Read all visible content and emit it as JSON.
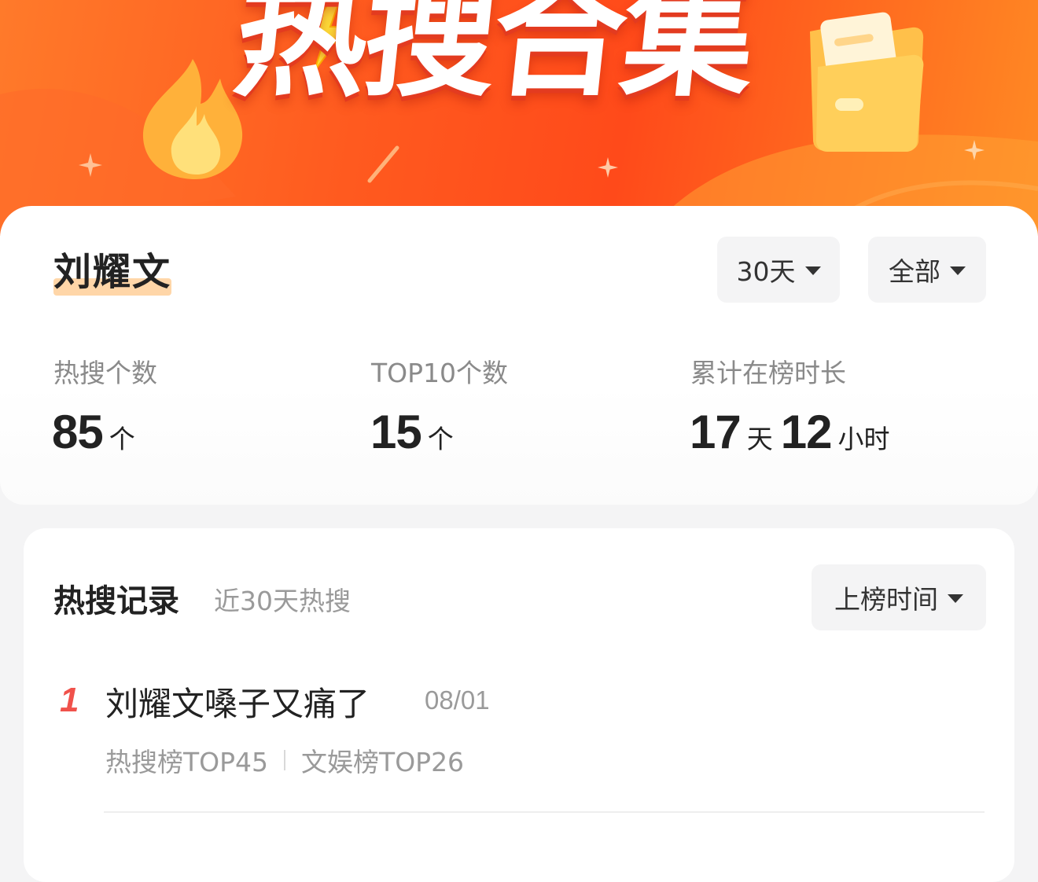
{
  "banner": {
    "title": "热搜合集",
    "colors": {
      "base": "#ff5a1f",
      "flame": "#ffb13a",
      "folder": "#ffc04a"
    },
    "icons": [
      "flame-icon",
      "lightning-icon",
      "folder-icon",
      "sparkle-icon"
    ]
  },
  "summary": {
    "name": "刘耀文",
    "filters": {
      "period": "30天",
      "scope": "全部"
    },
    "stats": [
      {
        "label": "热搜个数",
        "value": "85",
        "unit": "个"
      },
      {
        "label": "TOP10个数",
        "value": "15",
        "unit": "个"
      },
      {
        "label": "累计在榜时长",
        "days": "17",
        "days_unit": "天",
        "hours": "12",
        "hours_unit": "小时"
      }
    ]
  },
  "records": {
    "title": "热搜记录",
    "subtitle": "近30天热搜",
    "sort": "上榜时间",
    "items": [
      {
        "rank": "1",
        "title": "刘耀文嗓子又痛了",
        "date": "08/01",
        "tags": [
          "热搜榜TOP45",
          "文娱榜TOP26"
        ]
      }
    ]
  },
  "colors": {
    "rank": "#f0524b",
    "name_highlight": "#ffd6a8",
    "muted_text": "#9a9a9a"
  }
}
